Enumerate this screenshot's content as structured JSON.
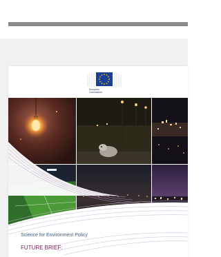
{
  "document": {
    "publisher_lines": [
      "European",
      "Commission"
    ],
    "series_title": "Science for Environment Policy",
    "brief_label": "FUTURE BRIEF:"
  },
  "colors": {
    "eu_blue": "#1b3f95",
    "eu_star": "#f6d000",
    "accent_purple": "#7a1f5c"
  }
}
